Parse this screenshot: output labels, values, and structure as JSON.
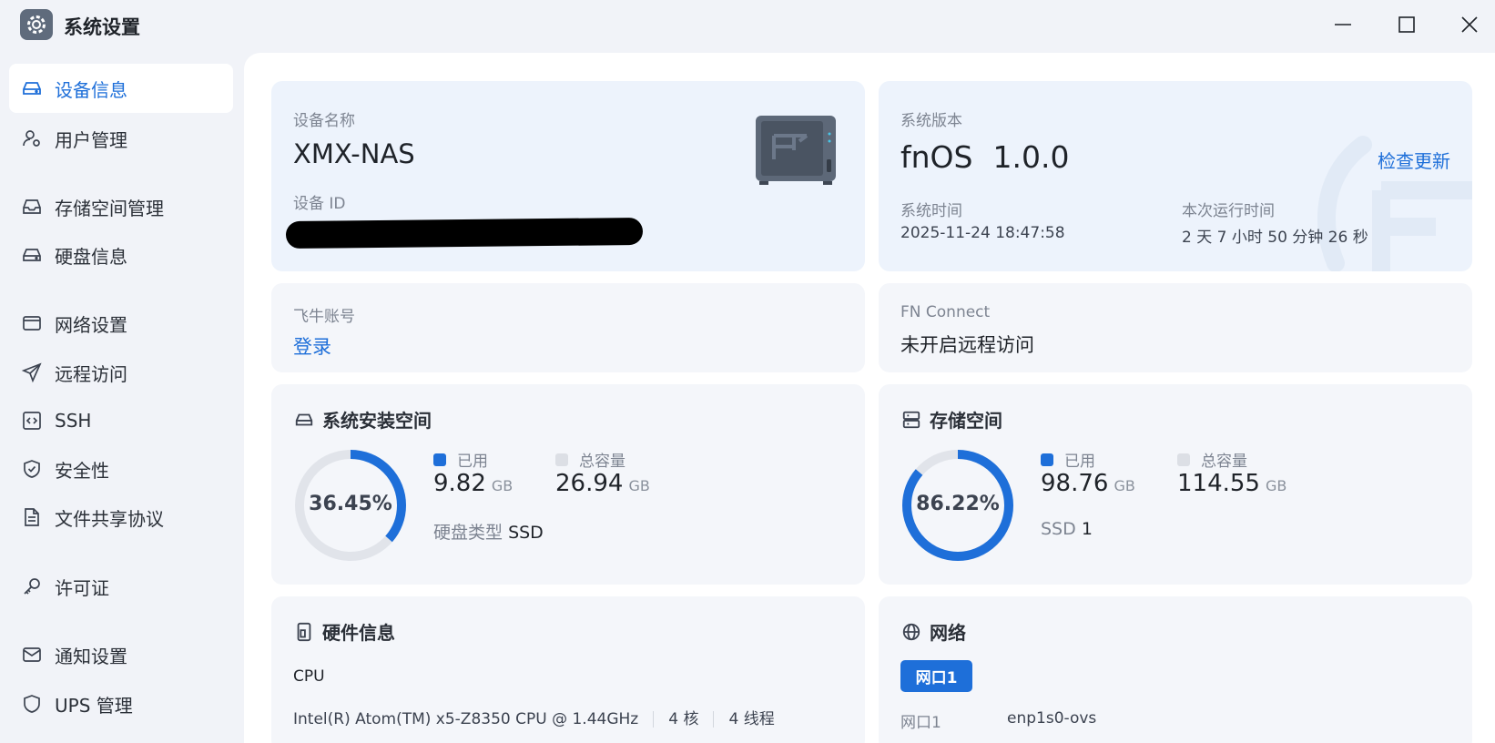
{
  "window": {
    "title": "系统设置"
  },
  "sidebar": {
    "items": [
      {
        "label": "设备信息",
        "icon": "drive-icon"
      },
      {
        "label": "用户管理",
        "icon": "user-gear-icon"
      },
      {
        "label": "存储空间管理",
        "icon": "inbox-icon"
      },
      {
        "label": "硬盘信息",
        "icon": "hard-disk-icon"
      },
      {
        "label": "网络设置",
        "icon": "window-icon"
      },
      {
        "label": "远程访问",
        "icon": "send-icon"
      },
      {
        "label": "SSH",
        "icon": "code-icon"
      },
      {
        "label": "安全性",
        "icon": "shield-check-icon"
      },
      {
        "label": "文件共享协议",
        "icon": "document-icon"
      },
      {
        "label": "许可证",
        "icon": "key-icon"
      },
      {
        "label": "通知设置",
        "icon": "mail-icon"
      },
      {
        "label": "UPS 管理",
        "icon": "shield-icon"
      }
    ],
    "active_index": 0
  },
  "device": {
    "name_label": "设备名称",
    "name": "XMX-NAS",
    "id_label": "设备 ID"
  },
  "system": {
    "version_label": "系统版本",
    "os_name": "fnOS",
    "os_version": "1.0.0",
    "check_update": "检查更新",
    "time_label": "系统时间",
    "time": "2025-11-24 18:47:58",
    "uptime_label": "本次运行时间",
    "uptime": "2 天 7 小时 50 分钟 26 秒"
  },
  "account": {
    "label": "飞牛账号",
    "login": "登录"
  },
  "fn_connect": {
    "label": "FN Connect",
    "status": "未开启远程访问"
  },
  "system_space": {
    "title": "系统安装空间",
    "percent_text": "36.45%",
    "percent": 0.3645,
    "used_label": "已用",
    "used_value": "9.82",
    "used_unit": "GB",
    "total_label": "总容量",
    "total_value": "26.94",
    "total_unit": "GB",
    "disk_type_label": "硬盘类型",
    "disk_type": "SSD"
  },
  "storage_space": {
    "title": "存储空间",
    "percent_text": "86.22%",
    "percent": 0.8622,
    "used_label": "已用",
    "used_value": "98.76",
    "used_unit": "GB",
    "total_label": "总容量",
    "total_value": "114.55",
    "total_unit": "GB",
    "ssd_label": "SSD",
    "ssd_count": "1"
  },
  "hardware": {
    "title": "硬件信息",
    "cpu_label": "CPU",
    "cpu_model": "Intel(R) Atom(TM) x5-Z8350 CPU @ 1.44GHz",
    "cores": "4 核",
    "threads": "4 线程"
  },
  "network": {
    "title": "网络",
    "tab": "网口1",
    "port_label": "网口1",
    "port_value": "enp1s0-ovs"
  },
  "colors": {
    "accent": "#1e6fd9",
    "track": "#e1e4ea",
    "legend_total": "#dcdfe5"
  }
}
